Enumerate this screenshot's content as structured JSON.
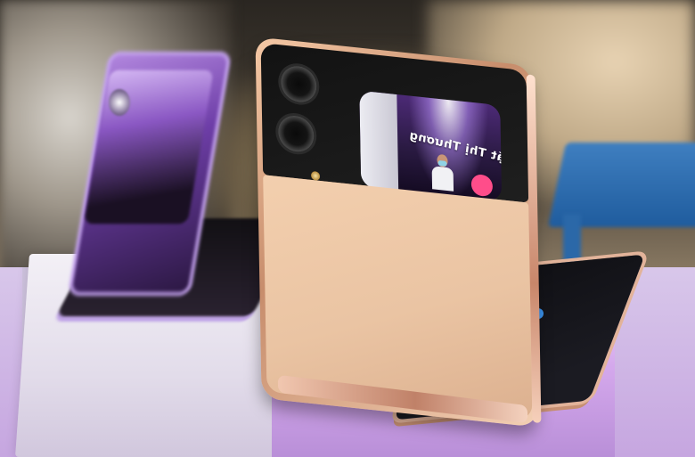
{
  "scene": {
    "cover_screen_text": "Mặt Thị Thương",
    "colors": {
      "main_phone_frame": "#d4a285",
      "main_phone_back": "#f3cfae",
      "main_phone_top_glass": "#141414",
      "left_phone": "#8a57c3",
      "pedestal": "#d4a8ec",
      "background_floor": "#d8c7ea",
      "blue_table": "#2f6fb0"
    },
    "icons": {
      "camera_lens": "camera-lens-icon",
      "flash": "flash-icon"
    }
  }
}
